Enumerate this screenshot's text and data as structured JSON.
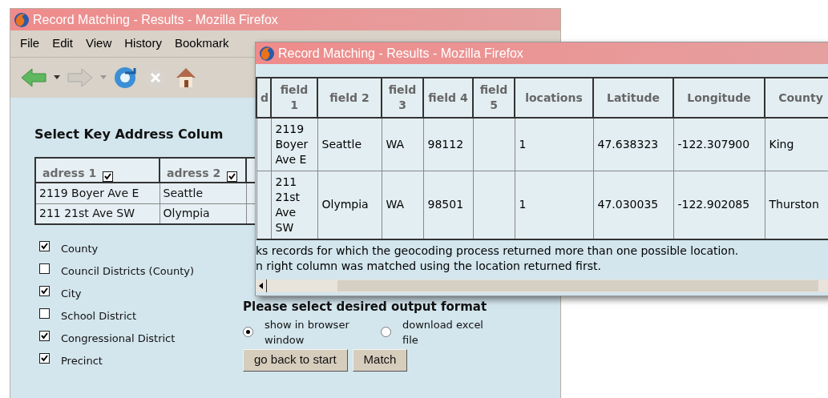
{
  "back_window": {
    "title": "Record Matching - Results - Mozilla Firefox",
    "menu": [
      {
        "label": "File"
      },
      {
        "label": "Edit"
      },
      {
        "label": "View"
      },
      {
        "label": "History"
      },
      {
        "label": "Bookmark"
      }
    ],
    "heading": "Select Key Address Colum",
    "table": {
      "columns": [
        {
          "label": "adress 1",
          "checked": true
        },
        {
          "label": "adress 2",
          "checked": true
        }
      ],
      "rows": [
        [
          "2119 Boyer Ave E",
          "Seattle"
        ],
        [
          "211 21st Ave SW",
          "Olympia"
        ]
      ]
    },
    "options": [
      {
        "label": "County",
        "checked": true
      },
      {
        "label": "Council Districts (County)",
        "checked": false
      },
      {
        "label": "City",
        "checked": true
      },
      {
        "label": "School District",
        "checked": false
      },
      {
        "label": "Congressional District",
        "checked": true
      },
      {
        "label": "Precinct",
        "checked": true
      }
    ],
    "output_heading": "Please select desired output format",
    "formats": [
      {
        "label": "show in browser window",
        "selected": true
      },
      {
        "label": "download excel file",
        "selected": false
      }
    ],
    "buttons": [
      "go back to start",
      "Match"
    ]
  },
  "front_window": {
    "title": "Record Matching - Results - Mozilla Firefox",
    "table": {
      "columns": [
        "d",
        "field 1",
        "field 2",
        "field 3",
        "field 4",
        "field 5",
        "locations",
        "Latitude",
        "Longitude",
        "County"
      ],
      "rows": [
        [
          "",
          "2119 Boyer Ave E",
          "Seattle",
          "WA",
          "98112",
          "",
          "1",
          "47.638323",
          "-122.307900",
          "King"
        ],
        [
          "",
          "211 21st Ave SW",
          "Olympia",
          "WA",
          "98501",
          "",
          "1",
          "47.030035",
          "-122.902085",
          "Thurston"
        ]
      ]
    },
    "note": [
      "ks records for which the geocoding process returned more than one possible location.",
      "n right column was matched using the location returned first."
    ]
  }
}
